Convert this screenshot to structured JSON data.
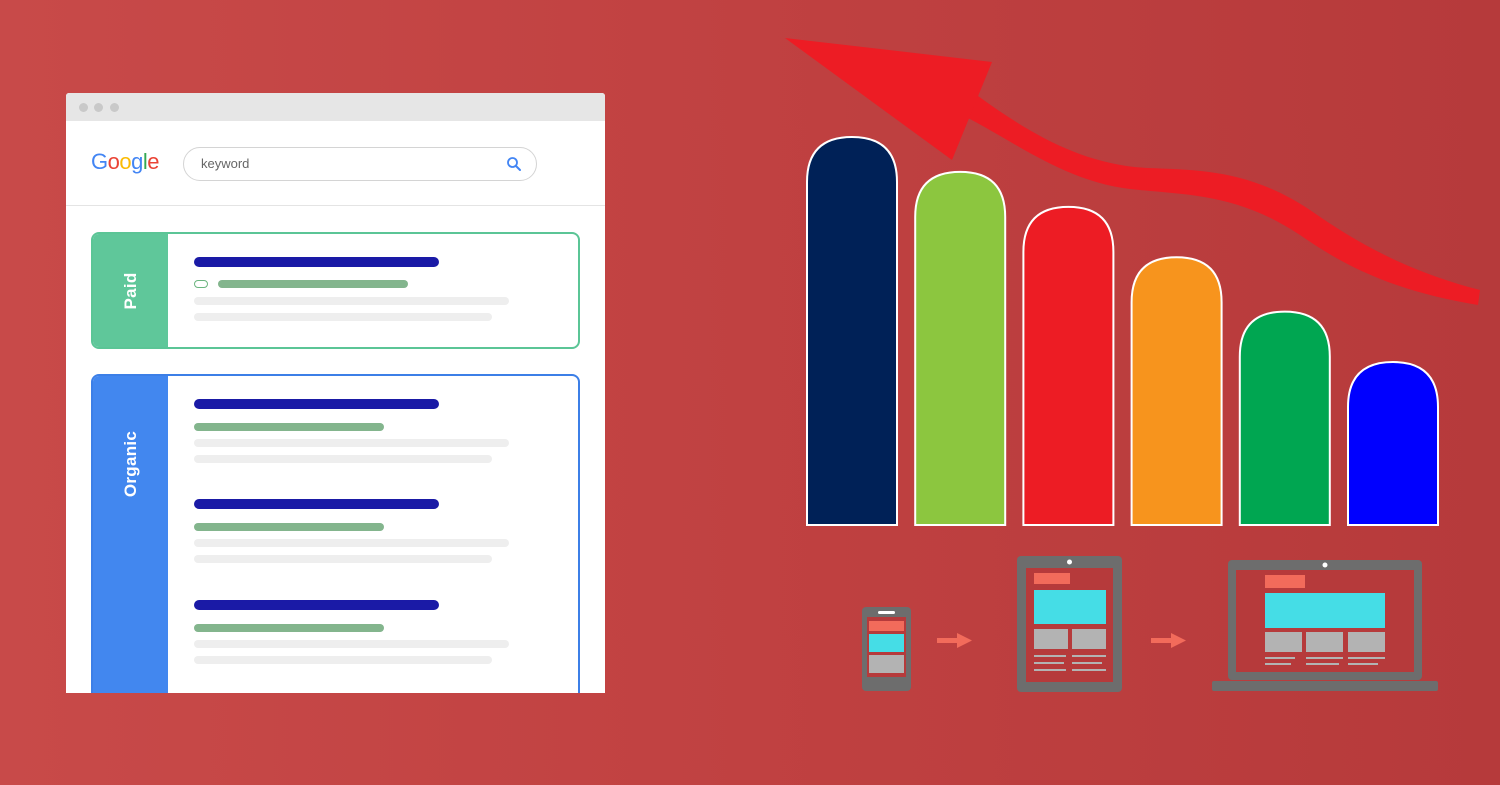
{
  "browser": {
    "logo_letters": [
      {
        "char": "G",
        "color": "#4285f4"
      },
      {
        "char": "o",
        "color": "#ea4335"
      },
      {
        "char": "o",
        "color": "#fbbc05"
      },
      {
        "char": "g",
        "color": "#4285f4"
      },
      {
        "char": "l",
        "color": "#34a853"
      },
      {
        "char": "e",
        "color": "#ea4335"
      }
    ],
    "search": {
      "value": "keyword"
    },
    "paid_label": "Paid",
    "organic_label": "Organic"
  },
  "chart_data": {
    "type": "bar",
    "categories": [
      "",
      "",
      "",
      "",
      "",
      ""
    ],
    "values": [
      100,
      91,
      82,
      69,
      55,
      42
    ],
    "colors": [
      "#002157",
      "#8cc63f",
      "#ed1c24",
      "#f7941d",
      "#00a651",
      "#0000ff"
    ],
    "grid": false,
    "trend_arrow": {
      "color": "#ed1c24",
      "direction": "up-left"
    }
  },
  "devices": {
    "icons": [
      "phone-icon",
      "tablet-icon",
      "laptop-icon"
    ],
    "arrow_color": "#f26b5b",
    "device_color": "#6d6d6d",
    "highlight_color": "#f26b5b",
    "accent_color": "#45dde6",
    "placeholder_color": "#b3b3b3"
  }
}
